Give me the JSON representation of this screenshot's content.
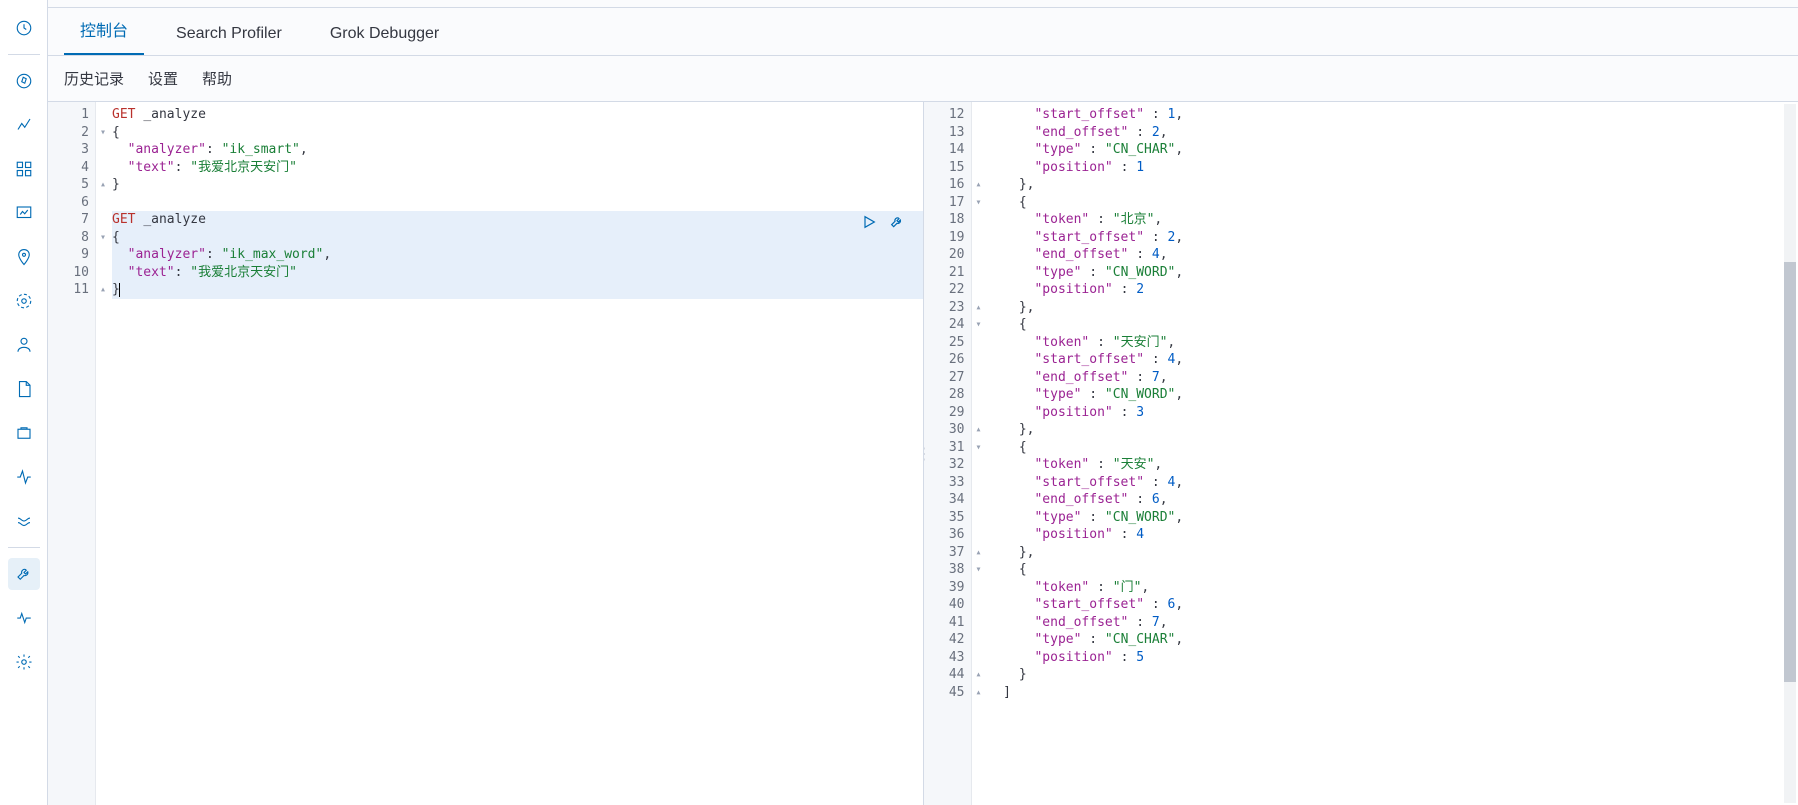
{
  "sidebar": {
    "icons": [
      "recent",
      "discover",
      "dashboard",
      "canvas",
      "maps",
      "ml",
      "graph",
      "logs",
      "uptime",
      "apm",
      "dev-tools",
      "monitoring",
      "management"
    ]
  },
  "tabs": {
    "items": [
      "控制台",
      "Search Profiler",
      "Grok Debugger"
    ],
    "active": 0
  },
  "subtabs": {
    "items": [
      "历史记录",
      "设置",
      "帮助"
    ]
  },
  "editor": {
    "lines": [
      {
        "n": "1",
        "fold": "",
        "type": "req",
        "method": "GET",
        "path": "_analyze"
      },
      {
        "n": "2",
        "fold": "▾",
        "type": "brace",
        "text": "{"
      },
      {
        "n": "3",
        "fold": "",
        "type": "kv",
        "key": "\"analyzer\"",
        "val": "\"ik_smart\"",
        "comma": ","
      },
      {
        "n": "4",
        "fold": "",
        "type": "kv",
        "key": "\"text\"",
        "val": "\"我爱北京天安门\"",
        "comma": ""
      },
      {
        "n": "5",
        "fold": "▴",
        "type": "brace",
        "text": "}"
      },
      {
        "n": "6",
        "fold": "",
        "type": "empty"
      },
      {
        "n": "7",
        "fold": "",
        "type": "req",
        "method": "GET",
        "path": "_analyze",
        "hl": true
      },
      {
        "n": "8",
        "fold": "▾",
        "type": "brace",
        "text": "{",
        "hl": true
      },
      {
        "n": "9",
        "fold": "",
        "type": "kv",
        "key": "\"analyzer\"",
        "val": "\"ik_max_word\"",
        "comma": ",",
        "hl": true
      },
      {
        "n": "10",
        "fold": "",
        "type": "kv",
        "key": "\"text\"",
        "val": "\"我爱北京天安门\"",
        "comma": "",
        "hl": true
      },
      {
        "n": "11",
        "fold": "▴",
        "type": "brace",
        "text": "}",
        "hl": true,
        "cursor": true
      }
    ]
  },
  "output": {
    "start": 12,
    "lines": [
      {
        "n": "12",
        "fold": "",
        "ind": 3,
        "type": "kvn",
        "key": "\"start_offset\"",
        "val": "1",
        "comma": ","
      },
      {
        "n": "13",
        "fold": "",
        "ind": 3,
        "type": "kvn",
        "key": "\"end_offset\"",
        "val": "2",
        "comma": ","
      },
      {
        "n": "14",
        "fold": "",
        "ind": 3,
        "type": "kvs",
        "key": "\"type\"",
        "val": "\"CN_CHAR\"",
        "comma": ","
      },
      {
        "n": "15",
        "fold": "",
        "ind": 3,
        "type": "kvn",
        "key": "\"position\"",
        "val": "1",
        "comma": ""
      },
      {
        "n": "16",
        "fold": "▴",
        "ind": 2,
        "type": "brace",
        "text": "},"
      },
      {
        "n": "17",
        "fold": "▾",
        "ind": 2,
        "type": "brace",
        "text": "{"
      },
      {
        "n": "18",
        "fold": "",
        "ind": 3,
        "type": "kvs",
        "key": "\"token\"",
        "val": "\"北京\"",
        "comma": ","
      },
      {
        "n": "19",
        "fold": "",
        "ind": 3,
        "type": "kvn",
        "key": "\"start_offset\"",
        "val": "2",
        "comma": ","
      },
      {
        "n": "20",
        "fold": "",
        "ind": 3,
        "type": "kvn",
        "key": "\"end_offset\"",
        "val": "4",
        "comma": ","
      },
      {
        "n": "21",
        "fold": "",
        "ind": 3,
        "type": "kvs",
        "key": "\"type\"",
        "val": "\"CN_WORD\"",
        "comma": ","
      },
      {
        "n": "22",
        "fold": "",
        "ind": 3,
        "type": "kvn",
        "key": "\"position\"",
        "val": "2",
        "comma": ""
      },
      {
        "n": "23",
        "fold": "▴",
        "ind": 2,
        "type": "brace",
        "text": "},"
      },
      {
        "n": "24",
        "fold": "▾",
        "ind": 2,
        "type": "brace",
        "text": "{"
      },
      {
        "n": "25",
        "fold": "",
        "ind": 3,
        "type": "kvs",
        "key": "\"token\"",
        "val": "\"天安门\"",
        "comma": ","
      },
      {
        "n": "26",
        "fold": "",
        "ind": 3,
        "type": "kvn",
        "key": "\"start_offset\"",
        "val": "4",
        "comma": ","
      },
      {
        "n": "27",
        "fold": "",
        "ind": 3,
        "type": "kvn",
        "key": "\"end_offset\"",
        "val": "7",
        "comma": ","
      },
      {
        "n": "28",
        "fold": "",
        "ind": 3,
        "type": "kvs",
        "key": "\"type\"",
        "val": "\"CN_WORD\"",
        "comma": ","
      },
      {
        "n": "29",
        "fold": "",
        "ind": 3,
        "type": "kvn",
        "key": "\"position\"",
        "val": "3",
        "comma": ""
      },
      {
        "n": "30",
        "fold": "▴",
        "ind": 2,
        "type": "brace",
        "text": "},"
      },
      {
        "n": "31",
        "fold": "▾",
        "ind": 2,
        "type": "brace",
        "text": "{"
      },
      {
        "n": "32",
        "fold": "",
        "ind": 3,
        "type": "kvs",
        "key": "\"token\"",
        "val": "\"天安\"",
        "comma": ","
      },
      {
        "n": "33",
        "fold": "",
        "ind": 3,
        "type": "kvn",
        "key": "\"start_offset\"",
        "val": "4",
        "comma": ","
      },
      {
        "n": "34",
        "fold": "",
        "ind": 3,
        "type": "kvn",
        "key": "\"end_offset\"",
        "val": "6",
        "comma": ","
      },
      {
        "n": "35",
        "fold": "",
        "ind": 3,
        "type": "kvs",
        "key": "\"type\"",
        "val": "\"CN_WORD\"",
        "comma": ","
      },
      {
        "n": "36",
        "fold": "",
        "ind": 3,
        "type": "kvn",
        "key": "\"position\"",
        "val": "4",
        "comma": ""
      },
      {
        "n": "37",
        "fold": "▴",
        "ind": 2,
        "type": "brace",
        "text": "},"
      },
      {
        "n": "38",
        "fold": "▾",
        "ind": 2,
        "type": "brace",
        "text": "{"
      },
      {
        "n": "39",
        "fold": "",
        "ind": 3,
        "type": "kvs",
        "key": "\"token\"",
        "val": "\"门\"",
        "comma": ","
      },
      {
        "n": "40",
        "fold": "",
        "ind": 3,
        "type": "kvn",
        "key": "\"start_offset\"",
        "val": "6",
        "comma": ","
      },
      {
        "n": "41",
        "fold": "",
        "ind": 3,
        "type": "kvn",
        "key": "\"end_offset\"",
        "val": "7",
        "comma": ","
      },
      {
        "n": "42",
        "fold": "",
        "ind": 3,
        "type": "kvs",
        "key": "\"type\"",
        "val": "\"CN_CHAR\"",
        "comma": ","
      },
      {
        "n": "43",
        "fold": "",
        "ind": 3,
        "type": "kvn",
        "key": "\"position\"",
        "val": "5",
        "comma": ""
      },
      {
        "n": "44",
        "fold": "▴",
        "ind": 2,
        "type": "brace",
        "text": "}"
      },
      {
        "n": "45",
        "fold": "▴",
        "ind": 1,
        "type": "brace",
        "text": "]"
      }
    ]
  }
}
